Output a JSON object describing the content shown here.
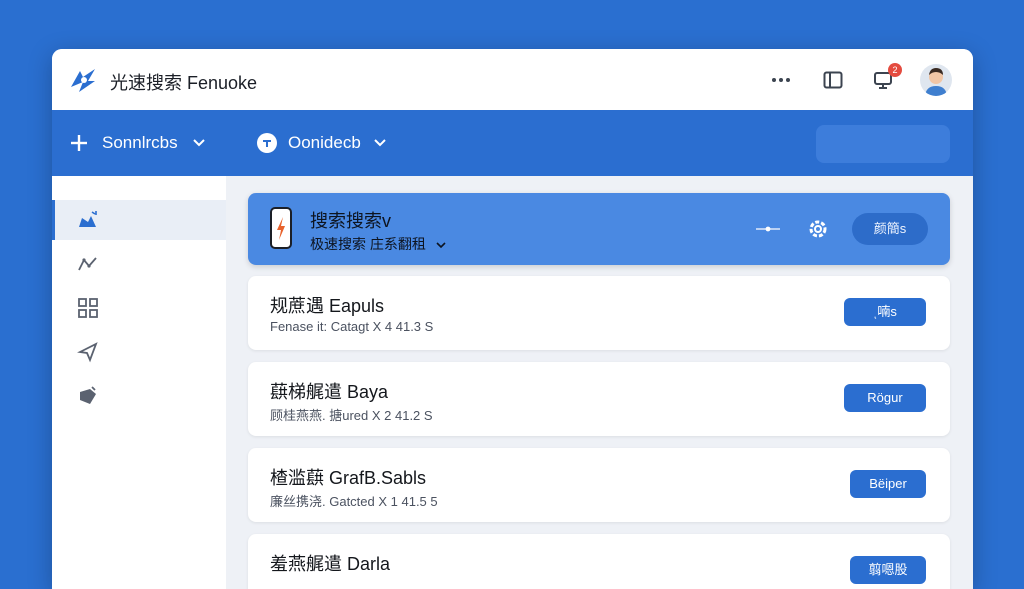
{
  "header": {
    "title": "光速搜索 Fenuoke",
    "notification_count": "2"
  },
  "toolbar": {
    "new_label": "Sonnlrcbs",
    "assist_label": "Oonidecb"
  },
  "featured": {
    "title": "搜索搜索v",
    "subtitle": "极速搜索 庄系翻租",
    "button": "颜簡s"
  },
  "results": [
    {
      "title": "规蔗遇 Eapuls",
      "subtitle": "Fenase it: Catagt X 4 41.3 S",
      "button": "ͺ喃s"
    },
    {
      "title": "蕻梯艉遣 Baya",
      "subtitle": "顾桂燕燕. 搪ured X 2 41.2 S",
      "button": "Rögur"
    },
    {
      "title": "楂滥蕻 GrafB.Sabls",
      "subtitle": "廉丝携浇. Gatcted X 1 41.5 5",
      "button": "Bëiper"
    },
    {
      "title": "羞燕艉遣 Darla",
      "subtitle": "",
      "button": "翦嗯股"
    }
  ],
  "colors": {
    "background": "#2a6fd0",
    "accent": "#2b6ed0",
    "featured": "#4a89e2"
  }
}
